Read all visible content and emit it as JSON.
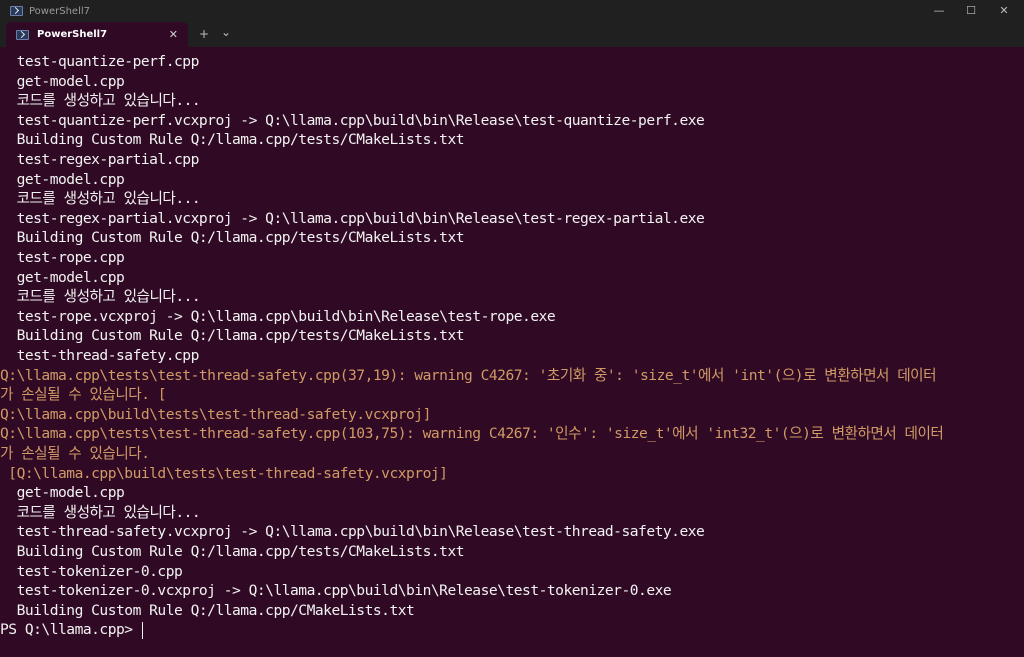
{
  "window": {
    "title": "PowerShell7",
    "tab_label": "PowerShell7",
    "tab_close": "✕",
    "new_tab": "+",
    "dropdown": "⌄",
    "minimize": "—",
    "maximize": "☐",
    "close": "✕"
  },
  "colors": {
    "background": "#300a24",
    "text": "#f2f2f2",
    "warning": "#d19a66",
    "titlebar": "#202020"
  },
  "terminal": {
    "lines": [
      {
        "text": "  test-quantize-perf.cpp",
        "type": "normal"
      },
      {
        "text": "  get-model.cpp",
        "type": "normal"
      },
      {
        "text": "  코드를 생성하고 있습니다...",
        "type": "normal"
      },
      {
        "text": "  test-quantize-perf.vcxproj -> Q:\\llama.cpp\\build\\bin\\Release\\test-quantize-perf.exe",
        "type": "normal"
      },
      {
        "text": "  Building Custom Rule Q:/llama.cpp/tests/CMakeLists.txt",
        "type": "normal"
      },
      {
        "text": "  test-regex-partial.cpp",
        "type": "normal"
      },
      {
        "text": "  get-model.cpp",
        "type": "normal"
      },
      {
        "text": "  코드를 생성하고 있습니다...",
        "type": "normal"
      },
      {
        "text": "  test-regex-partial.vcxproj -> Q:\\llama.cpp\\build\\bin\\Release\\test-regex-partial.exe",
        "type": "normal"
      },
      {
        "text": "  Building Custom Rule Q:/llama.cpp/tests/CMakeLists.txt",
        "type": "normal"
      },
      {
        "text": "  test-rope.cpp",
        "type": "normal"
      },
      {
        "text": "  get-model.cpp",
        "type": "normal"
      },
      {
        "text": "  코드를 생성하고 있습니다...",
        "type": "normal"
      },
      {
        "text": "  test-rope.vcxproj -> Q:\\llama.cpp\\build\\bin\\Release\\test-rope.exe",
        "type": "normal"
      },
      {
        "text": "  Building Custom Rule Q:/llama.cpp/tests/CMakeLists.txt",
        "type": "normal"
      },
      {
        "text": "  test-thread-safety.cpp",
        "type": "normal"
      },
      {
        "text": "Q:\\llama.cpp\\tests\\test-thread-safety.cpp(37,19): warning C4267: '초기화 중': 'size_t'에서 'int'(으)로 변환하면서 데이터",
        "type": "warn"
      },
      {
        "text": "가 손실될 수 있습니다. [",
        "type": "warn"
      },
      {
        "text": "Q:\\llama.cpp\\build\\tests\\test-thread-safety.vcxproj]",
        "type": "warn"
      },
      {
        "text": "Q:\\llama.cpp\\tests\\test-thread-safety.cpp(103,75): warning C4267: '인수': 'size_t'에서 'int32_t'(으)로 변환하면서 데이터",
        "type": "warn"
      },
      {
        "text": "가 손실될 수 있습니다.",
        "type": "warn"
      },
      {
        "text": " [Q:\\llama.cpp\\build\\tests\\test-thread-safety.vcxproj]",
        "type": "warn"
      },
      {
        "text": "  get-model.cpp",
        "type": "normal"
      },
      {
        "text": "  코드를 생성하고 있습니다...",
        "type": "normal"
      },
      {
        "text": "  test-thread-safety.vcxproj -> Q:\\llama.cpp\\build\\bin\\Release\\test-thread-safety.exe",
        "type": "normal"
      },
      {
        "text": "  Building Custom Rule Q:/llama.cpp/tests/CMakeLists.txt",
        "type": "normal"
      },
      {
        "text": "  test-tokenizer-0.cpp",
        "type": "normal"
      },
      {
        "text": "  test-tokenizer-0.vcxproj -> Q:\\llama.cpp\\build\\bin\\Release\\test-tokenizer-0.exe",
        "type": "normal"
      },
      {
        "text": "  Building Custom Rule Q:/llama.cpp/CMakeLists.txt",
        "type": "normal"
      }
    ],
    "prompt": "PS Q:\\llama.cpp> "
  }
}
